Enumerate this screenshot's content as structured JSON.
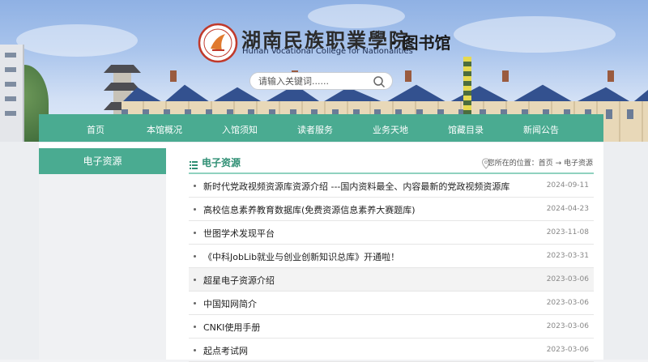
{
  "header": {
    "college_name": "湖南民族职業學院",
    "college_name_en": "Hunan Vocational College for Nationalities",
    "library": "· 图书馆",
    "logo_icon": "college-emblem-icon"
  },
  "search": {
    "placeholder": "请输入关键词......",
    "icon": "search-icon"
  },
  "nav": {
    "items": [
      "首页",
      "本馆概况",
      "入馆须知",
      "读者服务",
      "业务天地",
      "馆藏目录",
      "新闻公告"
    ]
  },
  "sidebar": {
    "title": "电子资源"
  },
  "main": {
    "title": "电子资源",
    "location_label": "您所在的位置：首页 → 电子资源",
    "accent_color": "#4aab91",
    "articles": [
      {
        "title": "新时代党政视频资源库资源介绍 ---国内资料最全、内容最新的党政视频资源库",
        "date": "2024-09-11"
      },
      {
        "title": "高校信息素养教育数据库(免费资源信息素养大赛题库)",
        "date": "2024-04-23"
      },
      {
        "title": "世图学术发现平台",
        "date": "2023-11-08"
      },
      {
        "title": "《中科JobLib就业与创业创新知识总库》开通啦！",
        "date": "2023-03-31"
      },
      {
        "title": "超星电子资源介绍",
        "date": "2023-03-06"
      },
      {
        "title": "中国知网简介",
        "date": "2023-03-06"
      },
      {
        "title": "CNKI使用手册",
        "date": "2023-03-06"
      },
      {
        "title": "起点考试网",
        "date": "2023-03-06"
      }
    ]
  }
}
